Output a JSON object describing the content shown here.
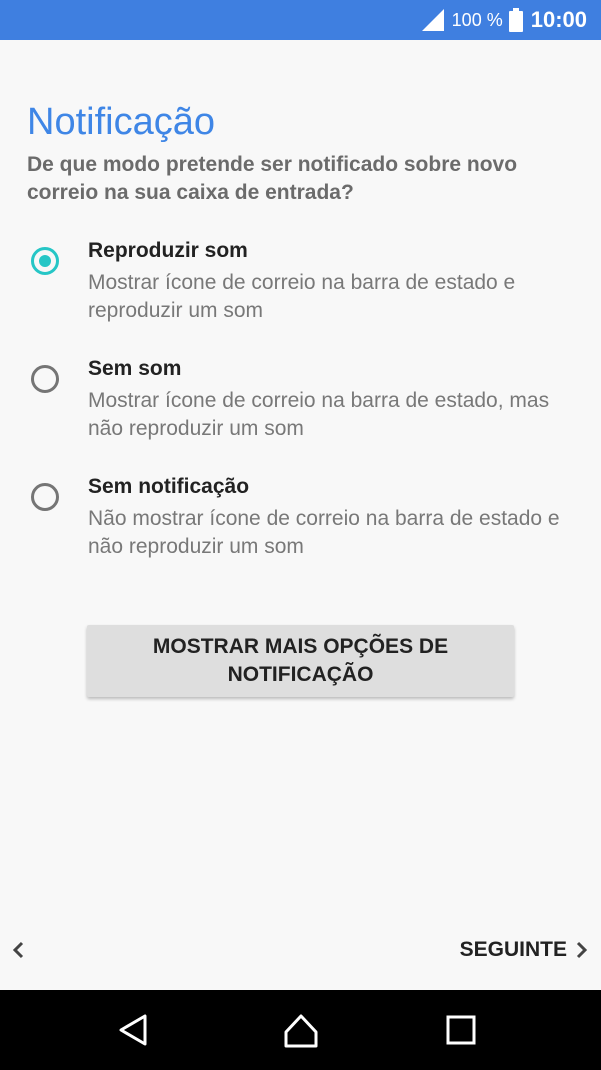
{
  "status_bar": {
    "battery_percent": "100 %",
    "time": "10:00",
    "icons": [
      "signal-icon",
      "battery-icon"
    ]
  },
  "screen": {
    "title": "Notificação",
    "question": "De que modo pretende ser notificado sobre novo correio na sua caixa de entrada?",
    "options": [
      {
        "title": "Reproduzir som",
        "description": "Mostrar ícone de correio na barra de estado e reproduzir um som",
        "selected": true
      },
      {
        "title": "Sem som",
        "description": "Mostrar ícone de correio na barra de estado, mas não reproduzir um som",
        "selected": false
      },
      {
        "title": "Sem notificação",
        "description": "Não mostrar ícone de correio na barra de estado e não reproduzir um som",
        "selected": false
      }
    ],
    "more_options_button": "MOSTRAR MAIS OPÇÕES DE NOTIFICAÇÃO"
  },
  "footer": {
    "next_label": "SEGUINTE",
    "icons": [
      "back-chevron-icon",
      "next-chevron-icon"
    ]
  },
  "nav_bar": {
    "icons": [
      "back-triangle-icon",
      "home-icon",
      "recents-icon"
    ]
  },
  "colors": {
    "status_bar": "#3f7fe0",
    "title": "#3f86e6",
    "accent": "#26c6c6",
    "background": "#f8f8f8"
  }
}
